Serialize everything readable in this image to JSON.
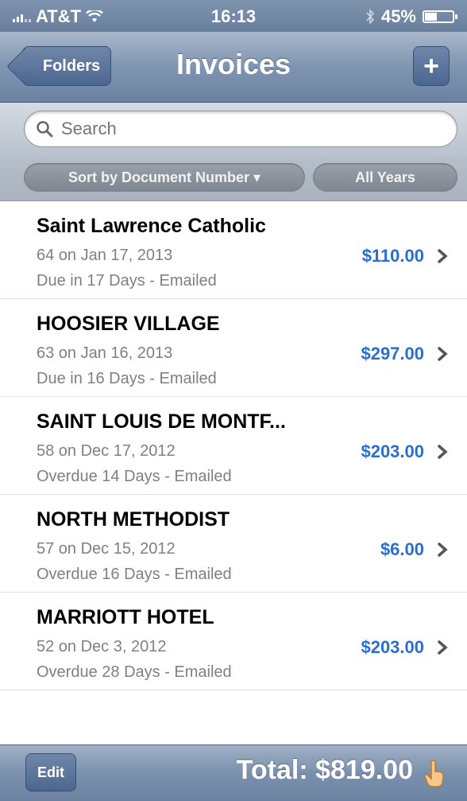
{
  "status_bar": {
    "carrier": "AT&T",
    "time": "16:13",
    "battery": "45%",
    "battery_level": 0.45,
    "icons": [
      "signal-icon",
      "wifi-icon",
      "bluetooth-icon",
      "battery-icon"
    ]
  },
  "nav": {
    "back_label": "Folders",
    "title": "Invoices",
    "add_label": "+"
  },
  "search": {
    "placeholder": "Search"
  },
  "sort": {
    "sort_label": "Sort by Document Number ▾",
    "year_label": "All Years"
  },
  "invoices": [
    {
      "name": "Saint Lawrence Catholic",
      "line2": "64 on Jan 17, 2013",
      "line3": "Due in 17 Days - Emailed",
      "amount": "$110.00"
    },
    {
      "name": "HOOSIER VILLAGE",
      "line2": "63 on Jan 16, 2013",
      "line3": "Due in 16 Days - Emailed",
      "amount": "$297.00"
    },
    {
      "name": "SAINT LOUIS DE MONTF...",
      "line2": "58 on Dec 17, 2012",
      "line3": "Overdue 14 Days - Emailed",
      "amount": "$203.00"
    },
    {
      "name": "NORTH METHODIST",
      "line2": "57 on Dec 15, 2012",
      "line3": "Overdue 16 Days - Emailed",
      "amount": "$6.00"
    },
    {
      "name": "MARRIOTT HOTEL",
      "line2": "52 on Dec 3, 2012",
      "line3": "Overdue 28 Days - Emailed",
      "amount": "$203.00"
    }
  ],
  "toolbar": {
    "edit_label": "Edit",
    "total": "Total: $819.00"
  },
  "colors": {
    "amount": "#2a6ed0",
    "nav_bar": "#7f95b1"
  }
}
